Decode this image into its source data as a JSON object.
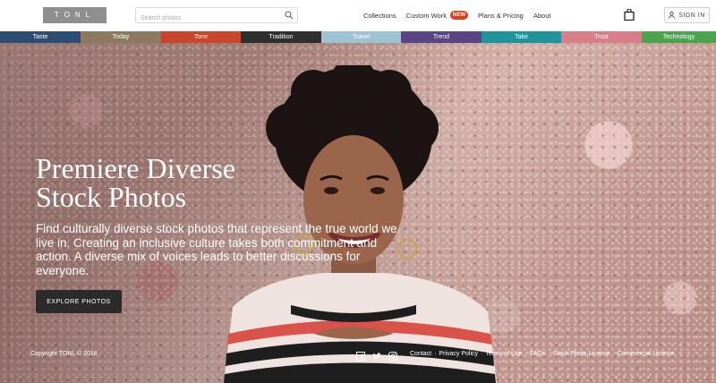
{
  "header": {
    "logo_text": "TONL",
    "search_placeholder": "Search photos",
    "nav": [
      {
        "label": "Collections"
      },
      {
        "label": "Custom Work",
        "badge": "NEW"
      },
      {
        "label": "Plans & Pricing"
      },
      {
        "label": "About"
      }
    ],
    "signin_label": "SIGN IN"
  },
  "categories": [
    {
      "label": "Taste",
      "color": "#2e4d74"
    },
    {
      "label": "Today",
      "color": "#8b7a5f"
    },
    {
      "label": "Tone",
      "color": "#c9452b"
    },
    {
      "label": "Tradition",
      "color": "#2f2f2f"
    },
    {
      "label": "Travel",
      "color": "#9cc3d1"
    },
    {
      "label": "Trend",
      "color": "#5a4483"
    },
    {
      "label": "Take",
      "color": "#21949b"
    },
    {
      "label": "Trust",
      "color": "#d77e86"
    },
    {
      "label": "Technology",
      "color": "#4aa44d"
    }
  ],
  "hero": {
    "title_line1": "Premiere Diverse",
    "title_line2": "Stock Photos",
    "description": "Find culturally diverse stock photos that represent the true world we live in. Creating an inclusive culture takes both commitment and action. A diverse mix of voices leads to better discussions for everyone.",
    "cta_label": "EXPLORE PHOTOS"
  },
  "footer": {
    "copyright": "Copyright TONL © 2018",
    "social_icons": [
      "facebook-icon",
      "twitter-icon",
      "instagram-icon"
    ],
    "links": [
      "Contact",
      "Privacy Policy",
      "Terms of Use",
      "FAQs",
      "Stock Photo License",
      "Commercial License"
    ]
  }
}
